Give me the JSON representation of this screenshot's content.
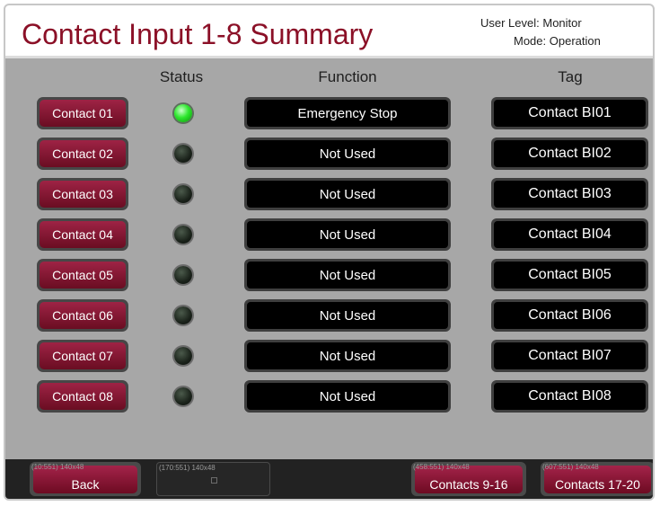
{
  "header": {
    "title": "Contact Input 1-8 Summary",
    "user_level": "User Level: Monitor",
    "mode": "Mode: Operation"
  },
  "columns": {
    "status": "Status",
    "function": "Function",
    "tag": "Tag"
  },
  "rows": [
    {
      "contact": "Contact 01",
      "status": "on",
      "function": "Emergency Stop",
      "tag": "Contact BI01"
    },
    {
      "contact": "Contact 02",
      "status": "off",
      "function": "Not Used",
      "tag": "Contact BI02"
    },
    {
      "contact": "Contact 03",
      "status": "off",
      "function": "Not Used",
      "tag": "Contact BI03"
    },
    {
      "contact": "Contact 04",
      "status": "off",
      "function": "Not Used",
      "tag": "Contact BI04"
    },
    {
      "contact": "Contact 05",
      "status": "off",
      "function": "Not Used",
      "tag": "Contact BI05"
    },
    {
      "contact": "Contact 06",
      "status": "off",
      "function": "Not Used",
      "tag": "Contact BI06"
    },
    {
      "contact": "Contact 07",
      "status": "off",
      "function": "Not Used",
      "tag": "Contact BI07"
    },
    {
      "contact": "Contact 08",
      "status": "off",
      "function": "Not Used",
      "tag": "Contact BI08"
    }
  ],
  "footer": {
    "back": {
      "label": "Back",
      "debug": "(10:551) 140x48"
    },
    "blank": {
      "debug": "(170:551) 140x48"
    },
    "contacts_9_16": {
      "label": "Contacts 9-16",
      "debug": "(458:551) 140x48"
    },
    "contacts_17_20": {
      "label": "Contacts 17-20",
      "debug": "(607:551) 140x48"
    }
  },
  "colors": {
    "title": "#8b1027",
    "button": "#8a1a36",
    "led_on": "#2ee82e",
    "led_off": "#1a221a",
    "panel": "#a7a7a7"
  }
}
